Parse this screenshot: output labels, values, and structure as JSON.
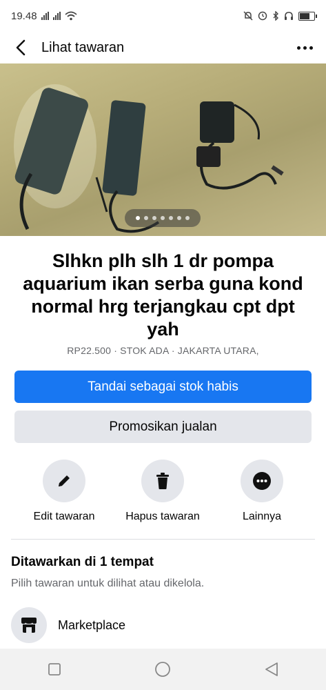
{
  "status_bar": {
    "time": "19.48",
    "icons": [
      "signal-icon",
      "signal-icon",
      "wifi-icon",
      "mute-icon",
      "alarm-icon",
      "bluetooth-icon",
      "headphones-icon",
      "battery-icon"
    ]
  },
  "header": {
    "title": "Lihat tawaran",
    "back_icon": "chevron-left-icon",
    "more_icon": "more-horizontal-icon"
  },
  "listing": {
    "photo_count": 7,
    "current_photo": 1,
    "title": "Slhkn plh slh 1 dr pompa aquarium ikan serba guna kond normal hrg terjangkau cpt dpt yah",
    "meta": "RP22.500 · STOK ADA · JAKARTA UTARA,"
  },
  "buttons": {
    "mark_sold": "Tandai sebagai stok habis",
    "promote": "Promosikan jualan"
  },
  "actions": [
    {
      "label": "Edit tawaran",
      "icon": "pencil-icon"
    },
    {
      "label": "Hapus tawaran",
      "icon": "trash-icon"
    },
    {
      "label": "Lainnya",
      "icon": "more-icon"
    }
  ],
  "offered_section": {
    "title": "Ditawarkan di 1 tempat",
    "subtitle": "Pilih tawaran untuk dilihat atau dikelola.",
    "items": [
      {
        "label": "Marketplace",
        "icon": "storefront-icon"
      }
    ]
  },
  "colors": {
    "primary": "#1877f2",
    "secondary_bg": "#e4e6eb",
    "muted_text": "#65676b"
  }
}
